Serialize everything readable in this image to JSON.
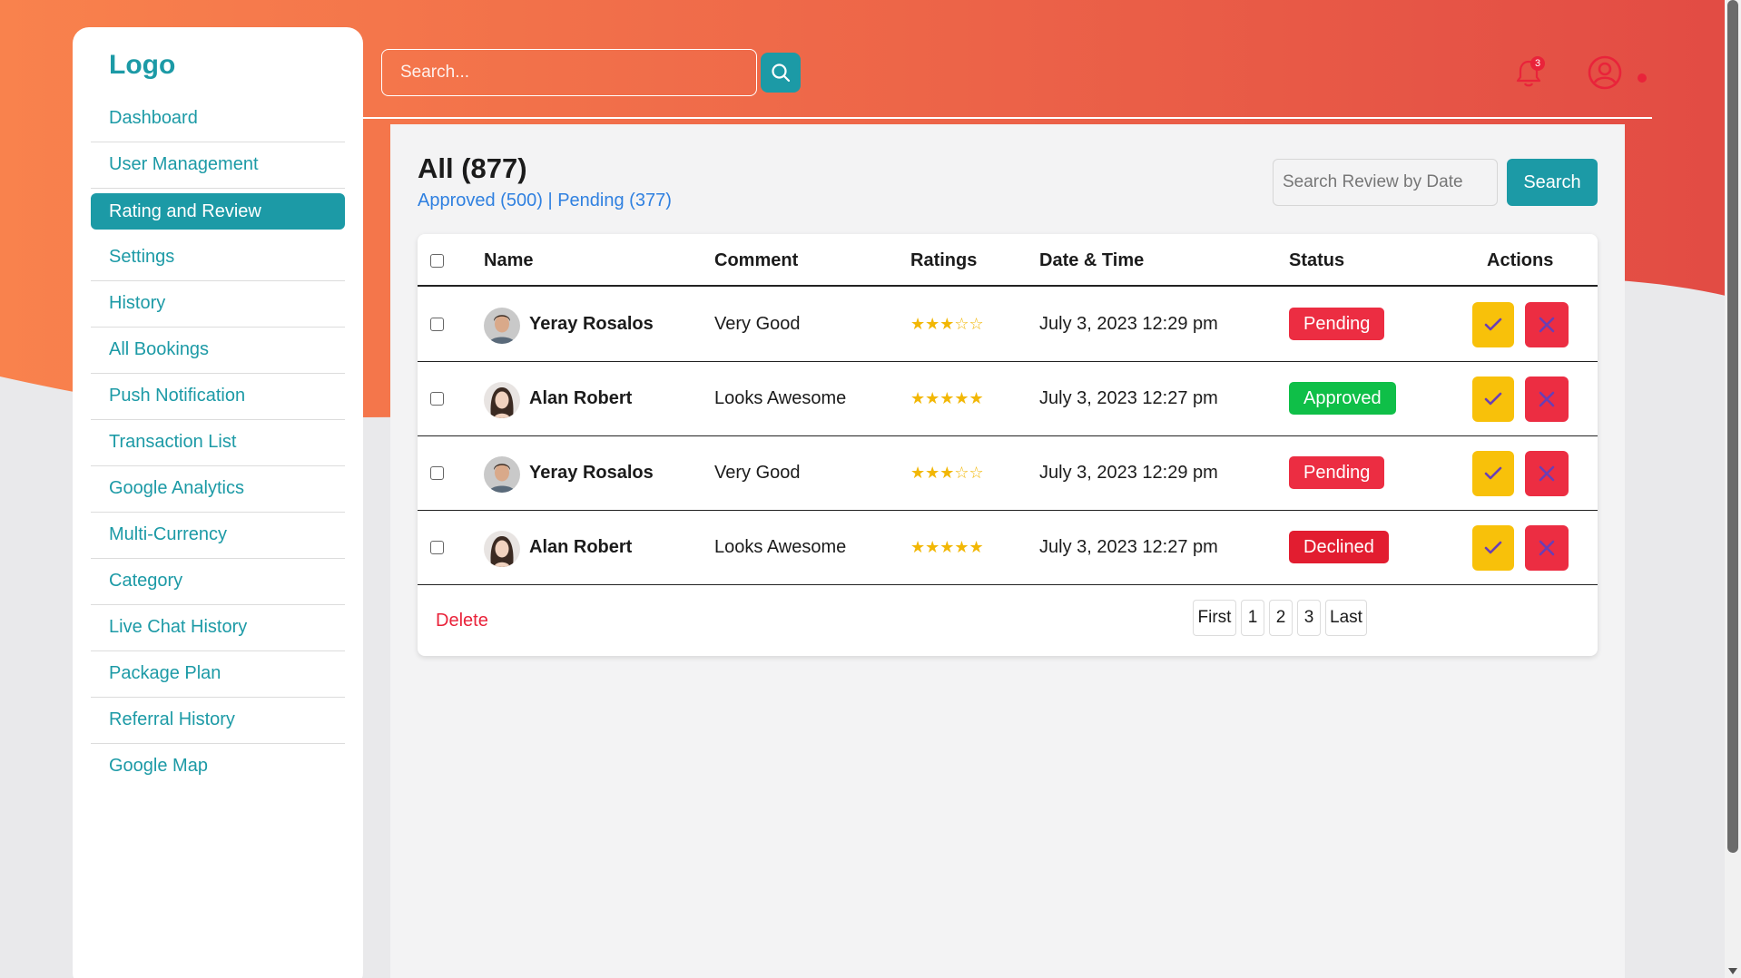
{
  "colors": {
    "accent": "#1c9aa6",
    "gradient_start": "#f9824d",
    "gradient_end": "#e24b44",
    "pending": "#ec2d42",
    "approved": "#0fbf48",
    "declined": "#e21d30",
    "approve_button": "#f8c10a",
    "reject_button": "#ec2d42",
    "link": "#2f80e0"
  },
  "sidebar": {
    "logo": "Logo",
    "items": [
      {
        "label": "Dashboard"
      },
      {
        "label": "User Management"
      },
      {
        "label": "Rating and Review",
        "active": true
      },
      {
        "label": "Settings"
      },
      {
        "label": "History"
      },
      {
        "label": "All Bookings"
      },
      {
        "label": "Push Notification"
      },
      {
        "label": "Transaction List"
      },
      {
        "label": "Google Analytics"
      },
      {
        "label": "Multi-Currency"
      },
      {
        "label": "Category"
      },
      {
        "label": "Live Chat History"
      },
      {
        "label": "Package Plan"
      },
      {
        "label": "Referral History"
      },
      {
        "label": "Google Map"
      }
    ]
  },
  "header": {
    "search_placeholder": "Search...",
    "search_icon": "search-icon",
    "notification_count": "3",
    "bell_icon": "bell-icon",
    "user_icon": "user-circle-icon"
  },
  "main": {
    "title": "All (877)",
    "filter_approved": "Approved (500)",
    "filter_separator": "|",
    "filter_pending": "Pending (377)",
    "date_search_placeholder": "Search Review by Date",
    "date_search_button": "Search"
  },
  "table": {
    "headers": {
      "name": "Name",
      "comment": "Comment",
      "ratings": "Ratings",
      "date": "Date & Time",
      "status": "Status",
      "actions": "Actions"
    },
    "rows": [
      {
        "name": "Yeray Rosalos",
        "avatar": "male",
        "comment": "Very Good",
        "rating": 3,
        "stars": "★★★☆☆",
        "date": "July 3, 2023 12:29 pm",
        "status": "Pending",
        "status_color": "#ec2d42"
      },
      {
        "name": "Alan Robert",
        "avatar": "female",
        "comment": "Looks Awesome",
        "rating": 5,
        "stars": "★★★★★",
        "date": "July 3, 2023 12:27 pm",
        "status": "Approved",
        "status_color": "#0fbf48"
      },
      {
        "name": "Yeray Rosalos",
        "avatar": "male",
        "comment": "Very Good",
        "rating": 3,
        "stars": "★★★☆☆",
        "date": "July 3, 2023 12:29 pm",
        "status": "Pending",
        "status_color": "#ec2d42"
      },
      {
        "name": "Alan Robert",
        "avatar": "female",
        "comment": "Looks Awesome",
        "rating": 5,
        "stars": "★★★★★",
        "date": "July 3, 2023 12:27 pm",
        "status": "Declined",
        "status_color": "#e21d30"
      }
    ],
    "approve_icon": "check-icon",
    "reject_icon": "close-icon"
  },
  "footer": {
    "delete_label": "Delete",
    "pagination": [
      "First",
      "1",
      "2",
      "3",
      "Last"
    ]
  }
}
